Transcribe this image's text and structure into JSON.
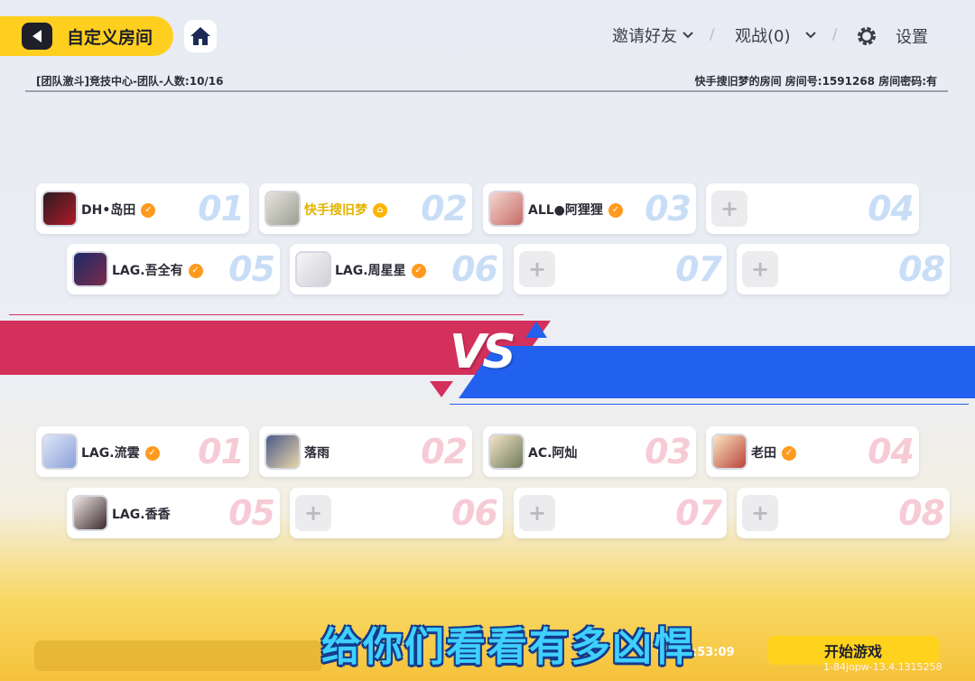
{
  "header": {
    "back_title": "自定义房间",
    "invite_label": "邀请好友",
    "spectate_label": "观战(0)",
    "settings_label": "设置"
  },
  "info": {
    "left": "[团队激斗]竞技中心-团队-人数:10/16",
    "right": "快手搜旧梦的房间 房间号:1591268 房间密码:有"
  },
  "blue_team": [
    {
      "num": "01",
      "name": "DH•岛田",
      "empty": false
    },
    {
      "num": "02",
      "name": "快手搜旧梦",
      "empty": false,
      "host": true
    },
    {
      "num": "03",
      "name": "ALL●阿狸狸",
      "empty": false
    },
    {
      "num": "04",
      "name": "",
      "empty": true
    },
    {
      "num": "05",
      "name": "LAG.吾全有",
      "empty": false
    },
    {
      "num": "06",
      "name": "LAG.周星星",
      "empty": false
    },
    {
      "num": "07",
      "name": "",
      "empty": true
    },
    {
      "num": "08",
      "name": "",
      "empty": true
    }
  ],
  "red_team": [
    {
      "num": "01",
      "name": "LAG.流雲",
      "empty": false
    },
    {
      "num": "02",
      "name": "落雨",
      "empty": false
    },
    {
      "num": "03",
      "name": "AC.阿灿",
      "empty": false
    },
    {
      "num": "04",
      "name": "老田",
      "empty": false
    },
    {
      "num": "05",
      "name": "LAG.香香",
      "empty": false
    },
    {
      "num": "06",
      "name": "",
      "empty": true
    },
    {
      "num": "07",
      "name": "",
      "empty": true
    },
    {
      "num": "08",
      "name": "",
      "empty": true
    }
  ],
  "vs_label": "VS",
  "subtitle": "给你们看看有多凶悍",
  "countdown": "倒计时:53:09",
  "start_label": "开始游戏",
  "version": "1-84jopw-13.4.1315258",
  "colors": {
    "accent": "#ffcf1f",
    "red_team": "#d3305c",
    "blue_team": "#2260ee"
  }
}
